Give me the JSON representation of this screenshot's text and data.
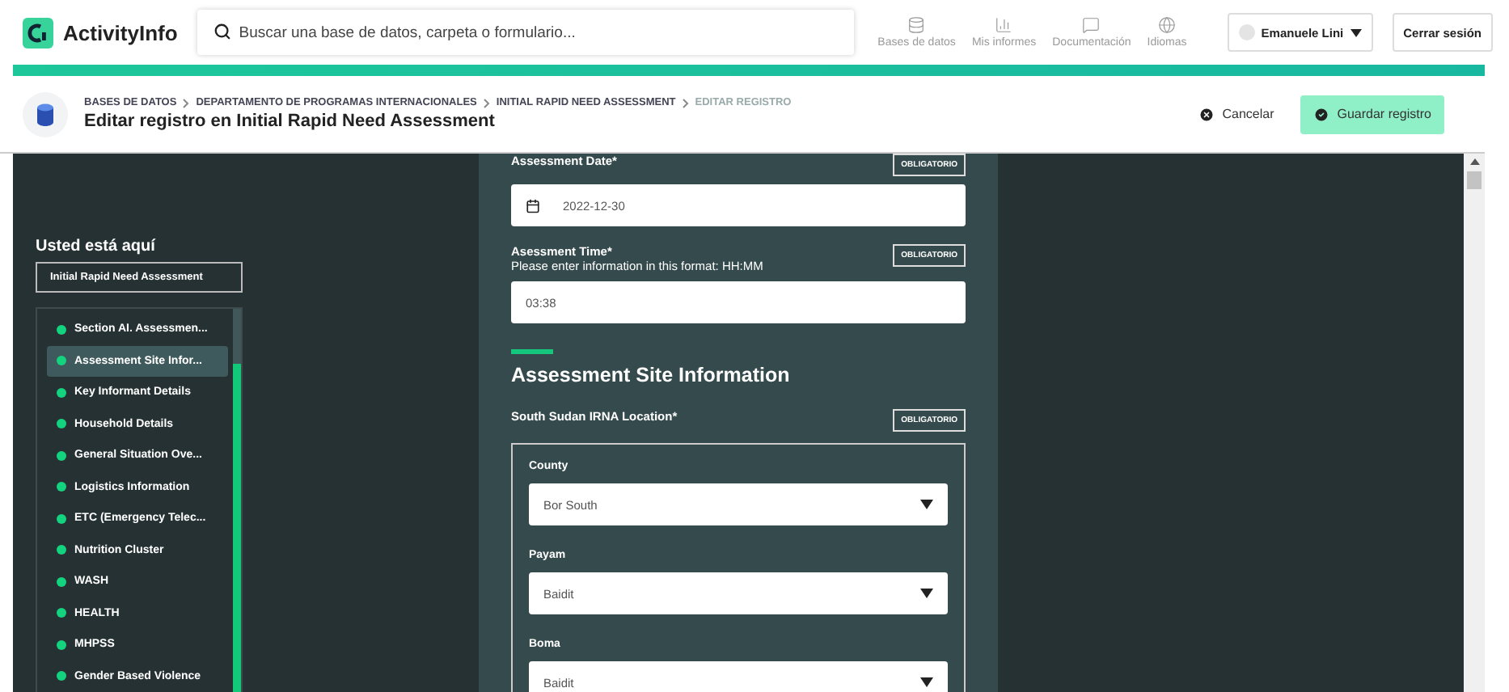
{
  "app": {
    "name": "ActivityInfo"
  },
  "search": {
    "placeholder": "Buscar una base de datos, carpeta o formulario..."
  },
  "nav": [
    {
      "label": "Bases de datos"
    },
    {
      "label": "Mis informes"
    },
    {
      "label": "Documentación"
    },
    {
      "label": "Idiomas"
    }
  ],
  "user": {
    "name": "Emanuele Lini"
  },
  "logout": "Cerrar sesión",
  "breadcrumb": [
    {
      "label": "BASES DE DATOS",
      "current": false
    },
    {
      "label": "DEPARTAMENTO DE PROGRAMAS INTERNACIONALES",
      "current": false
    },
    {
      "label": "INITIAL RAPID NEED ASSESSMENT",
      "current": false
    },
    {
      "label": "EDITAR REGISTRO",
      "current": true
    }
  ],
  "page_title": "Editar registro en Initial Rapid Need Assessment",
  "actions": {
    "cancel": "Cancelar",
    "save": "Guardar registro"
  },
  "sidebar": {
    "heading": "Usted está aquí",
    "form_name": "Initial Rapid Need Assessment",
    "sections": [
      {
        "label": "Section AI. Assessmen...",
        "selected": false
      },
      {
        "label": "Assessment Site Infor...",
        "selected": true
      },
      {
        "label": "Key Informant Details",
        "selected": false
      },
      {
        "label": "Household Details",
        "selected": false
      },
      {
        "label": "General Situation Ove...",
        "selected": false
      },
      {
        "label": "Logistics Information",
        "selected": false
      },
      {
        "label": "ETC (Emergency Telec...",
        "selected": false
      },
      {
        "label": "Nutrition Cluster",
        "selected": false
      },
      {
        "label": "WASH",
        "selected": false
      },
      {
        "label": "HEALTH",
        "selected": false
      },
      {
        "label": "MHPSS",
        "selected": false
      },
      {
        "label": "Gender Based Violence",
        "selected": false
      }
    ]
  },
  "fields": [
    {
      "kind": "date",
      "label": "Assessment Date*",
      "badge": "OBLIGATORIO",
      "value": "2022-12-30"
    },
    {
      "kind": "text",
      "label": "Asessment Time*",
      "hint": "Please enter information in this format: HH:MM",
      "badge": "OBLIGATORIO",
      "value": "03:38"
    }
  ],
  "section": {
    "title": "Assessment Site Information"
  },
  "location": {
    "label": "South Sudan IRNA Location*",
    "badge": "OBLIGATORIO",
    "levels": [
      {
        "label": "County",
        "value": "Bor South"
      },
      {
        "label": "Payam",
        "value": "Baidit"
      },
      {
        "label": "Boma",
        "value": "Baidit"
      }
    ]
  }
}
